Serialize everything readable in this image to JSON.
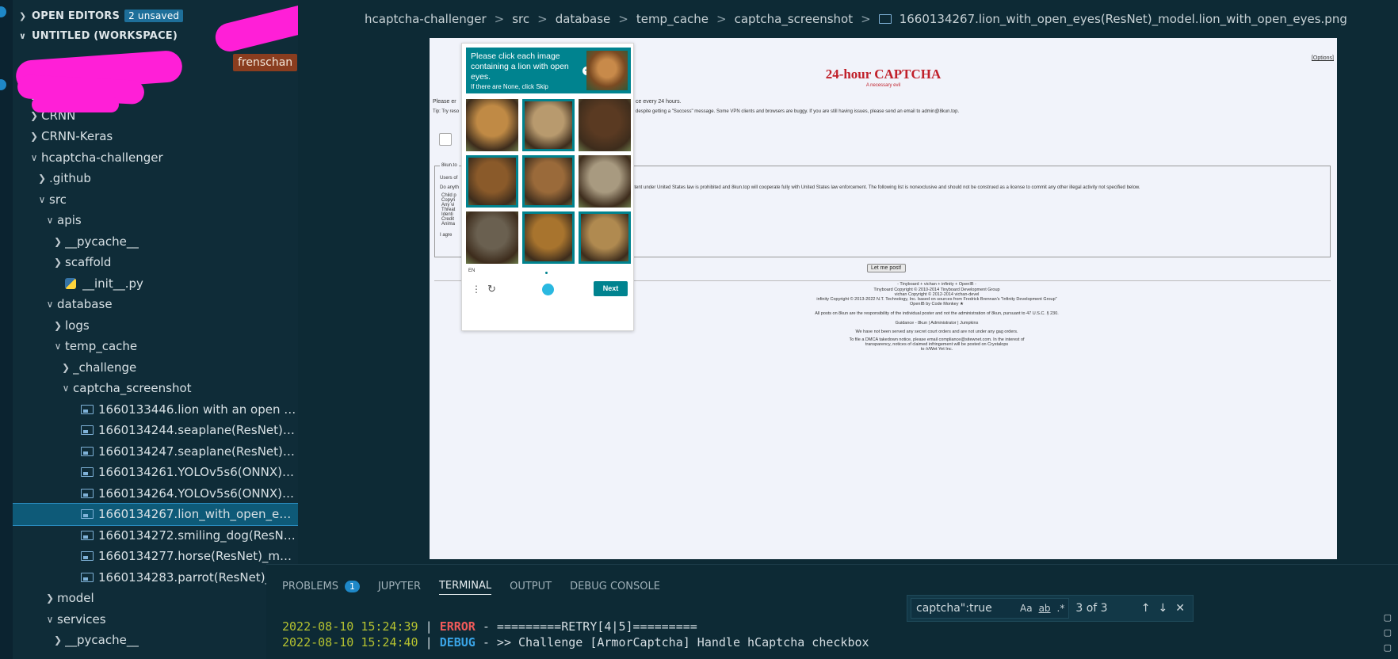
{
  "sidebar": {
    "open_editors_label": "OPEN EDITORS",
    "unsaved_badge": "2 unsaved",
    "workspace_label": "UNTITLED (WORKSPACE)",
    "tooltip": "frenschan",
    "tree": [
      {
        "label": "Cog",
        "indent": 1,
        "chev": ">",
        "kind": "folder"
      },
      {
        "label": "CRNN",
        "indent": 1,
        "chev": ">",
        "kind": "folder"
      },
      {
        "label": "CRNN-Keras",
        "indent": 1,
        "chev": ">",
        "kind": "folder"
      },
      {
        "label": "hcaptcha-challenger",
        "indent": 1,
        "chev": "v",
        "kind": "folder"
      },
      {
        "label": ".github",
        "indent": 2,
        "chev": ">",
        "kind": "folder"
      },
      {
        "label": "src",
        "indent": 2,
        "chev": "v",
        "kind": "folder"
      },
      {
        "label": "apis",
        "indent": 3,
        "chev": "v",
        "kind": "folder"
      },
      {
        "label": "__pycache__",
        "indent": 4,
        "chev": ">",
        "kind": "folder"
      },
      {
        "label": "scaffold",
        "indent": 4,
        "chev": ">",
        "kind": "folder"
      },
      {
        "label": "__init__.py",
        "indent": 4,
        "chev": "",
        "kind": "py"
      },
      {
        "label": "database",
        "indent": 3,
        "chev": "v",
        "kind": "folder"
      },
      {
        "label": "logs",
        "indent": 4,
        "chev": ">",
        "kind": "folder"
      },
      {
        "label": "temp_cache",
        "indent": 4,
        "chev": "v",
        "kind": "folder"
      },
      {
        "label": "_challenge",
        "indent": 5,
        "chev": ">",
        "kind": "folder"
      },
      {
        "label": "captcha_screenshot",
        "indent": 5,
        "chev": "v",
        "kind": "folder"
      },
      {
        "label": "1660133446.lion with an open mou...",
        "indent": 6,
        "chev": "",
        "kind": "img"
      },
      {
        "label": "1660134244.seaplane(ResNet)_mo...",
        "indent": 6,
        "chev": "",
        "kind": "img"
      },
      {
        "label": "1660134247.seaplane(ResNet)_mo...",
        "indent": 6,
        "chev": "",
        "kind": "img"
      },
      {
        "label": "1660134261.YOLOv5s6(ONNX)_mo...",
        "indent": 6,
        "chev": "",
        "kind": "img"
      },
      {
        "label": "1660134264.YOLOv5s6(ONNX)_m...",
        "indent": 6,
        "chev": "",
        "kind": "img"
      },
      {
        "label": "1660134267.lion_with_open_eyes(...",
        "indent": 6,
        "chev": "",
        "kind": "img",
        "selected": true
      },
      {
        "label": "1660134272.smiling_dog(ResNet)_...",
        "indent": 6,
        "chev": "",
        "kind": "img"
      },
      {
        "label": "1660134277.horse(ResNet)_model....",
        "indent": 6,
        "chev": "",
        "kind": "img"
      },
      {
        "label": "1660134283.parrot(ResNet)_model...",
        "indent": 6,
        "chev": "",
        "kind": "img"
      },
      {
        "label": "model",
        "indent": 3,
        "chev": ">",
        "kind": "folder"
      },
      {
        "label": "services",
        "indent": 3,
        "chev": "v",
        "kind": "folder"
      },
      {
        "label": "__pycache__",
        "indent": 4,
        "chev": ">",
        "kind": "folder"
      }
    ]
  },
  "breadcrumb": {
    "parts": [
      "hcaptcha-challenger",
      "src",
      "database",
      "temp_cache",
      "captcha_screenshot"
    ],
    "file": "1660134267.lion_with_open_eyes(ResNet)_model.lion_with_open_eyes.png"
  },
  "screenshot": {
    "title": "24-hour CAPTCHA",
    "subtitle": "A necessary evil",
    "options": "[Options]",
    "please_line": "Please er",
    "please_tail": "ce every 24 hours.",
    "tip_line": "Tip: Try reso",
    "tip_tail": "despite getting a \"Success\" message. Some VPN clients and browsers are buggy. If you are still having issues, please send an email to admin@8kun.top.",
    "box_label": "8kun.to",
    "box_users": "Users of",
    "box_do": "Do anyth",
    "box_law": "ntent under United States law is prohibited and 8kun.top will cooperate fully with United States law enforcement. The following list is nonexclusive and should not be construed as a license to commit any other illegal activity not specified below.",
    "box_items": [
      "Child p",
      "Copyri",
      "Any vi",
      "Threat",
      "Identi",
      "Credit",
      "Anima"
    ],
    "agree": "I agre",
    "post_button": "Let me post!",
    "footer": [
      "- Tinyboard + vichan + infinity + OpenIB -",
      "Tinyboard Copyright © 2010-2014 Tinyboard Development Group",
      "vichan Copyright © 2012-2014 vichan-devel",
      "infinity Copyright © 2013-2022 N.T. Technology, Inc. based on sources from Fredrick Brennan's \"Infinity Development Group\"",
      "OpenIB by Code Monkey ★",
      "All posts on 8kun are the responsibility of the individual poster and not the administration of 8kun, pursuant to 47 U.S.C. § 230.",
      "Guidance - 8kun | Administrator | Jumpkins",
      "We have not been served any secret court orders and are not under any gag orders.",
      "To file a DMCA takedown notice, please email compliance@sitewnet.com. In the interest of",
      "transparency, notices of claimed infringement will be posted on Crystalops",
      "to /r/Wet Yet Inc."
    ]
  },
  "captcha": {
    "prompt": "Please click each image containing a lion with open eyes.",
    "hint": "If there are None, click Skip",
    "lang": "EN",
    "next_label": "Next",
    "tiles": [
      {
        "selected": false,
        "tone": "#c08a45"
      },
      {
        "selected": true,
        "tone": "#b89a6e"
      },
      {
        "selected": false,
        "tone": "#5a3a22"
      },
      {
        "selected": true,
        "tone": "#8a5a2a"
      },
      {
        "selected": true,
        "tone": "#9a6a3a"
      },
      {
        "selected": false,
        "tone": "#a89a80"
      },
      {
        "selected": false,
        "tone": "#6a6050"
      },
      {
        "selected": true,
        "tone": "#a8742e"
      },
      {
        "selected": true,
        "tone": "#b08a50"
      }
    ]
  },
  "panel": {
    "tabs": [
      {
        "label": "PROBLEMS",
        "count": "1"
      },
      {
        "label": "JUPYTER"
      },
      {
        "label": "TERMINAL",
        "active": true
      },
      {
        "label": "OUTPUT"
      },
      {
        "label": "DEBUG CONSOLE"
      }
    ],
    "find": {
      "query": "captcha\":true",
      "result": "3 of 3",
      "opt_case": "Aa",
      "opt_word": "ab",
      "opt_regex": ".*"
    },
    "terminal": [
      {
        "ts": "2022-08-10 15:24:39",
        "level": "ERROR",
        "msg": " - =========RETRY[4|5]========="
      },
      {
        "ts": "2022-08-10 15:24:40",
        "level": "DEBUG",
        "msg": " - >> Challenge [ArmorCaptcha] Handle hCaptcha checkbox"
      }
    ]
  },
  "colors": {
    "accent": "#1e88c8",
    "captcha_teal": "#00838f",
    "annotation": "#ff1fd7"
  }
}
